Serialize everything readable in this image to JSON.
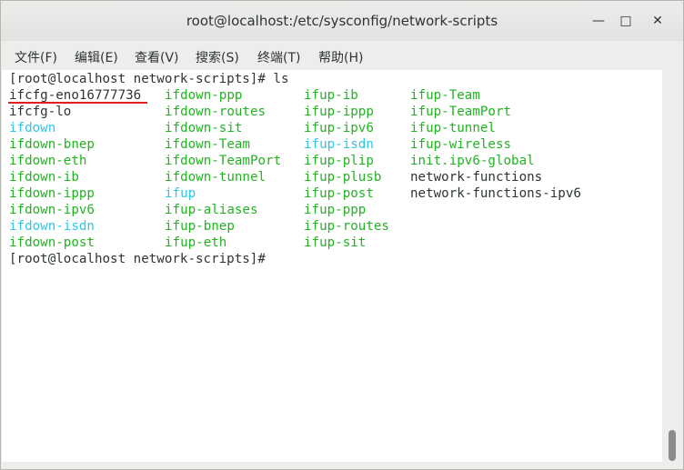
{
  "window": {
    "title": "root@localhost:/etc/sysconfig/network-scripts",
    "minimize_glyph": "—",
    "maximize_glyph": "□",
    "close_glyph": "✕"
  },
  "menu": {
    "file": "文件(F)",
    "edit": "编辑(E)",
    "view": "查看(V)",
    "search": "搜索(S)",
    "terminal": "终端(T)",
    "help": "帮助(H)"
  },
  "terminal": {
    "prompt1": "[root@localhost network-scripts]# ls",
    "prompt2": "[root@localhost network-scripts]# ",
    "colors": {
      "green": "#22b322",
      "cyan": "#2ec7e6",
      "default": "#2e3436",
      "highlight_underline": "#e02020"
    },
    "rows": [
      [
        "ifcfg-eno16777736",
        "ifdown-ppp",
        "ifup-ib",
        "ifup-Team"
      ],
      [
        "ifcfg-lo",
        "ifdown-routes",
        "ifup-ippp",
        "ifup-TeamPort"
      ],
      [
        "ifdown",
        "ifdown-sit",
        "ifup-ipv6",
        "ifup-tunnel"
      ],
      [
        "ifdown-bnep",
        "ifdown-Team",
        "ifup-isdn",
        "ifup-wireless"
      ],
      [
        "ifdown-eth",
        "ifdown-TeamPort",
        "ifup-plip",
        "init.ipv6-global"
      ],
      [
        "ifdown-ib",
        "ifdown-tunnel",
        "ifup-plusb",
        "network-functions"
      ],
      [
        "ifdown-ippp",
        "ifup",
        "ifup-post",
        "network-functions-ipv6"
      ],
      [
        "ifdown-ipv6",
        "ifup-aliases",
        "ifup-ppp",
        ""
      ],
      [
        "ifdown-isdn",
        "ifup-bnep",
        "ifup-routes",
        ""
      ],
      [
        "ifdown-post",
        "ifup-eth",
        "ifup-sit",
        ""
      ]
    ],
    "row_colors": [
      [
        "white",
        "green",
        "green",
        "green"
      ],
      [
        "white",
        "green",
        "green",
        "green"
      ],
      [
        "cyan",
        "green",
        "green",
        "green"
      ],
      [
        "green",
        "green",
        "cyan",
        "green"
      ],
      [
        "green",
        "green",
        "green",
        "green"
      ],
      [
        "green",
        "green",
        "green",
        "white"
      ],
      [
        "green",
        "cyan",
        "green",
        "white"
      ],
      [
        "green",
        "green",
        "green",
        ""
      ],
      [
        "cyan",
        "green",
        "green",
        ""
      ],
      [
        "green",
        "green",
        "green",
        ""
      ]
    ]
  }
}
